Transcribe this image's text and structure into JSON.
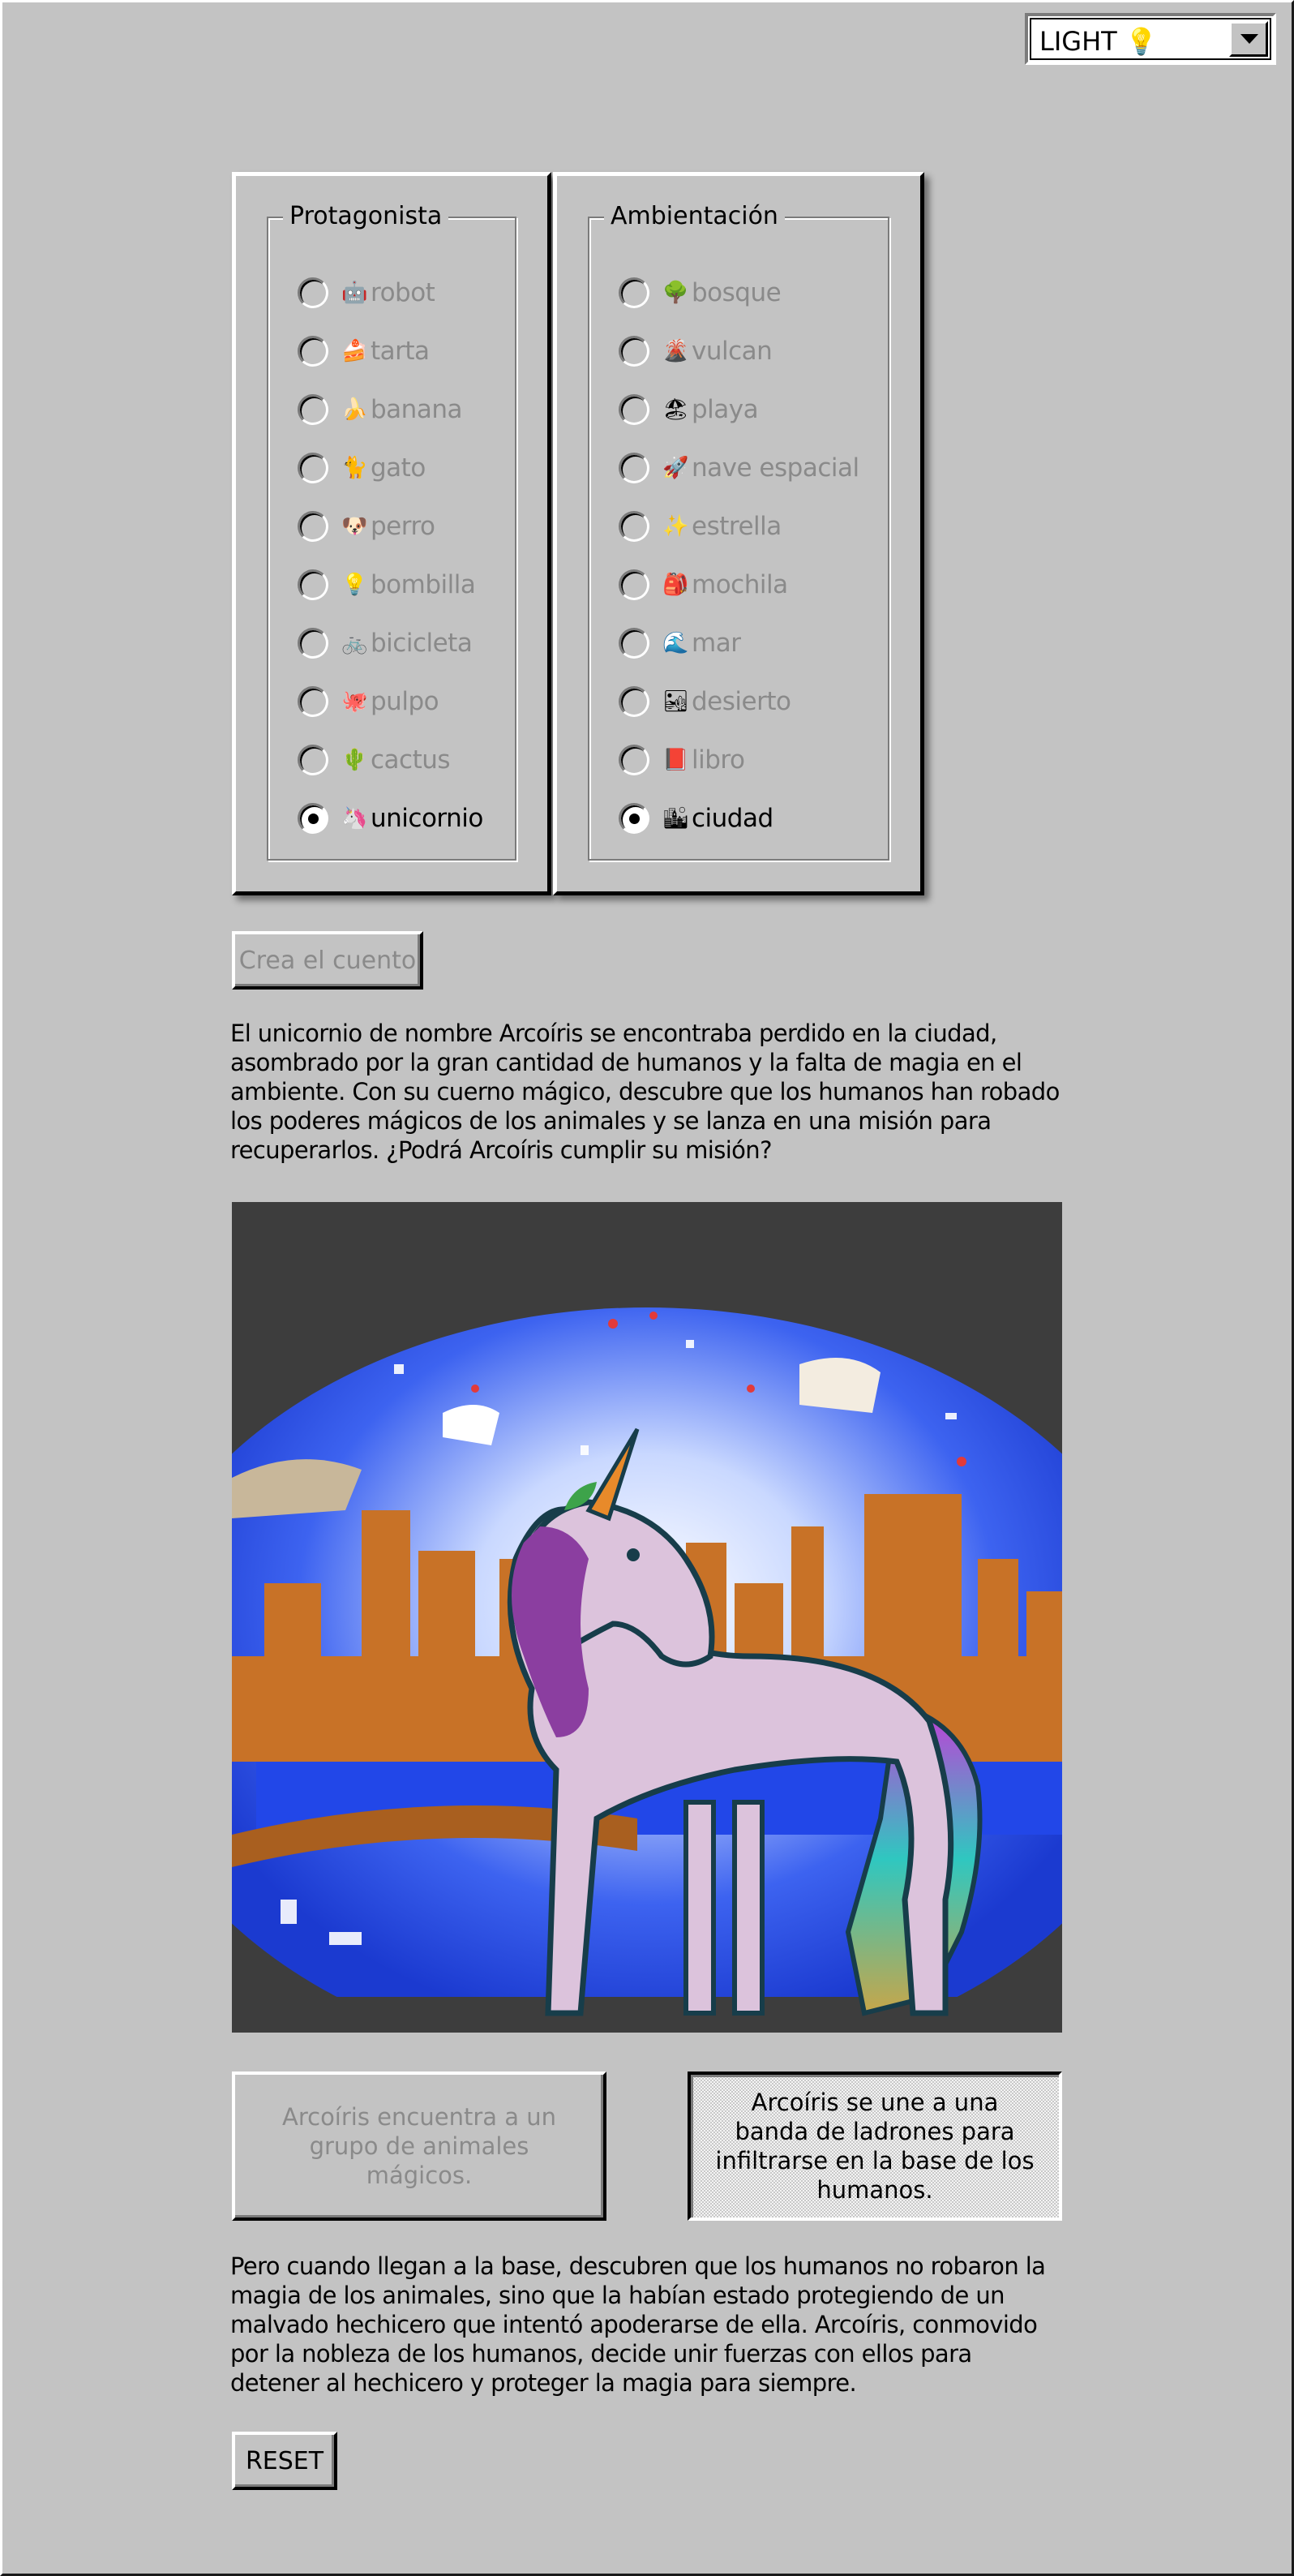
{
  "theme": {
    "label": "LIGHT 💡",
    "arrow_icon": "chevron-down-icon"
  },
  "protagonista": {
    "legend": "Protagonista",
    "options": [
      {
        "emoji": "🤖",
        "label": "robot",
        "selected": false
      },
      {
        "emoji": "🍰",
        "label": "tarta",
        "selected": false
      },
      {
        "emoji": "🍌",
        "label": "banana",
        "selected": false
      },
      {
        "emoji": "🐈",
        "label": "gato",
        "selected": false
      },
      {
        "emoji": "🐶",
        "label": "perro",
        "selected": false
      },
      {
        "emoji": "💡",
        "label": "bombilla",
        "selected": false
      },
      {
        "emoji": "🚲",
        "label": "bicicleta",
        "selected": false
      },
      {
        "emoji": "🐙",
        "label": "pulpo",
        "selected": false
      },
      {
        "emoji": "🌵",
        "label": "cactus",
        "selected": false
      },
      {
        "emoji": "🦄",
        "label": "unicornio",
        "selected": true
      }
    ]
  },
  "ambientacion": {
    "legend": "Ambientación",
    "options": [
      {
        "emoji": "🌳",
        "label": "bosque",
        "selected": false
      },
      {
        "emoji": "🌋",
        "label": "vulcan",
        "selected": false
      },
      {
        "emoji": "🏖",
        "label": "playa",
        "selected": false
      },
      {
        "emoji": "🚀",
        "label": "nave espacial",
        "selected": false
      },
      {
        "emoji": "✨",
        "label": "estrella",
        "selected": false
      },
      {
        "emoji": "🎒",
        "label": "mochila",
        "selected": false
      },
      {
        "emoji": "🌊",
        "label": "mar",
        "selected": false
      },
      {
        "emoji": "🏜",
        "label": "desierto",
        "selected": false
      },
      {
        "emoji": "📕",
        "label": "libro",
        "selected": false
      },
      {
        "emoji": "🏙",
        "label": "ciudad",
        "selected": true
      }
    ]
  },
  "create_button": "Crea el cuento",
  "story": "El unicornio de nombre Arcoíris se encontraba perdido en la ciudad, asombrado por la gran cantidad de humanos y la falta de magia en el ambiente. Con su cuerno mágico, descubre que los humanos han robado los poderes mágicos de los animales y se lanza en una misión para recuperarlos. ¿Podrá Arcoíris cumplir su misión?",
  "choices": [
    {
      "label": "Arcoíris encuentra a un grupo de animales mágicos.",
      "enabled": false
    },
    {
      "label": "Arcoíris se une a una banda de ladrones para infiltrarse en la base de los humanos.",
      "enabled": true
    }
  ],
  "continuation": "Pero cuando llegan a la base, descubren que los humanos no robaron la magia de los animales, sino que la habían estado protegiendo de un malvado hechicero que intentó apoderarse de ella. Arcoíris, conmovido por la nobleza de los humanos, decide unir fuerzas con ellos para detener al hechicero y proteger la magia para siempre.",
  "reset_button": "RESET",
  "colors": {
    "background": "#c3c3c3",
    "disabled_text": "#8a8a8a",
    "image_background": "#3d3d3d"
  }
}
